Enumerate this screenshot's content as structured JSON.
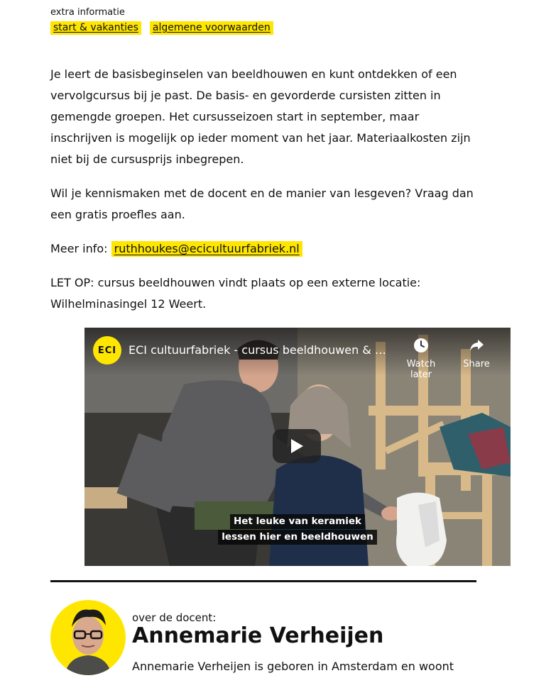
{
  "extra": {
    "label": "extra informatie",
    "tags": [
      "start & vakanties",
      "algemene voorwaarden"
    ]
  },
  "intro": {
    "paragraph1": "Je leert de basisbeginselen van beeldhouwen en kunt ontdekken of een vervolgcursus bij je past. De basis- en gevorderde cursisten zitten in gemengde groepen. Het cursusseizoen start in september, maar inschrijven is mogelijk op ieder moment van het jaar. Materiaalkosten zijn niet bij de cursusprijs inbegrepen.",
    "paragraph2": "Wil je kennismaken met de docent en de manier van lesgeven? Vraag dan een gratis proefles aan.",
    "more_info_label": "Meer info:",
    "email": "ruthhoukes@ecicultuurfabriek.nl",
    "notice_line1": "LET OP: cursus beeldhouwen vindt plaats op een externe locatie:",
    "notice_line2": "Wilhelminasingel 12 Weert."
  },
  "video": {
    "channel_logo": "ECI",
    "title": "ECI cultuurfabriek - cursus beeldhouwen & cursus keramiek",
    "watch_later": "Watch later",
    "share": "Share",
    "subtitle_line1": "Het leuke van keramiek",
    "subtitle_line2": "lessen hier en beeldhouwen",
    "icons": [
      "clock-icon",
      "share-icon",
      "play-icon"
    ]
  },
  "teacher": {
    "over_label": "over de docent:",
    "name": "Annemarie Verheijen",
    "bio_start": "Annemarie Verheijen is geboren in Amsterdam en woont"
  },
  "colors": {
    "accent": "#ffe600",
    "text": "#111111",
    "player_button": "#212121"
  }
}
